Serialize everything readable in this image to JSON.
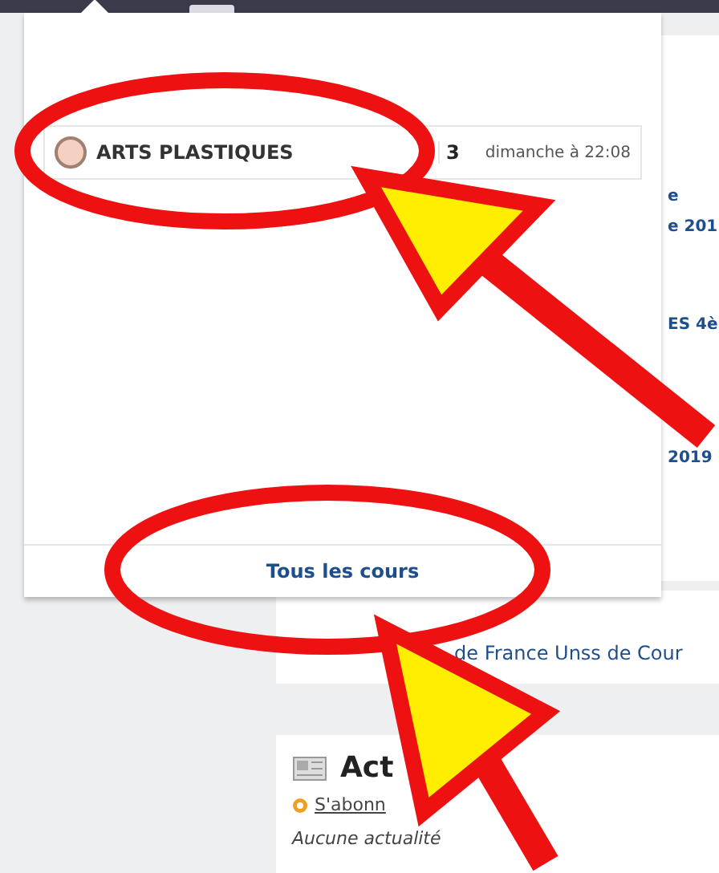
{
  "dropdown": {
    "courses": [
      {
        "name": "ARTS PLASTIQUES",
        "count": "3",
        "date": "dimanche à 22:08"
      }
    ],
    "footer_link": "Tous les cours"
  },
  "background_card": {
    "lines": [
      "e",
      "e 201",
      "ES 4è",
      "2019"
    ],
    "last_line": "de France Unss de Cour"
  },
  "news_card": {
    "title": "Act",
    "subscribe": "S'abonn",
    "empty": "Aucune actualité"
  }
}
